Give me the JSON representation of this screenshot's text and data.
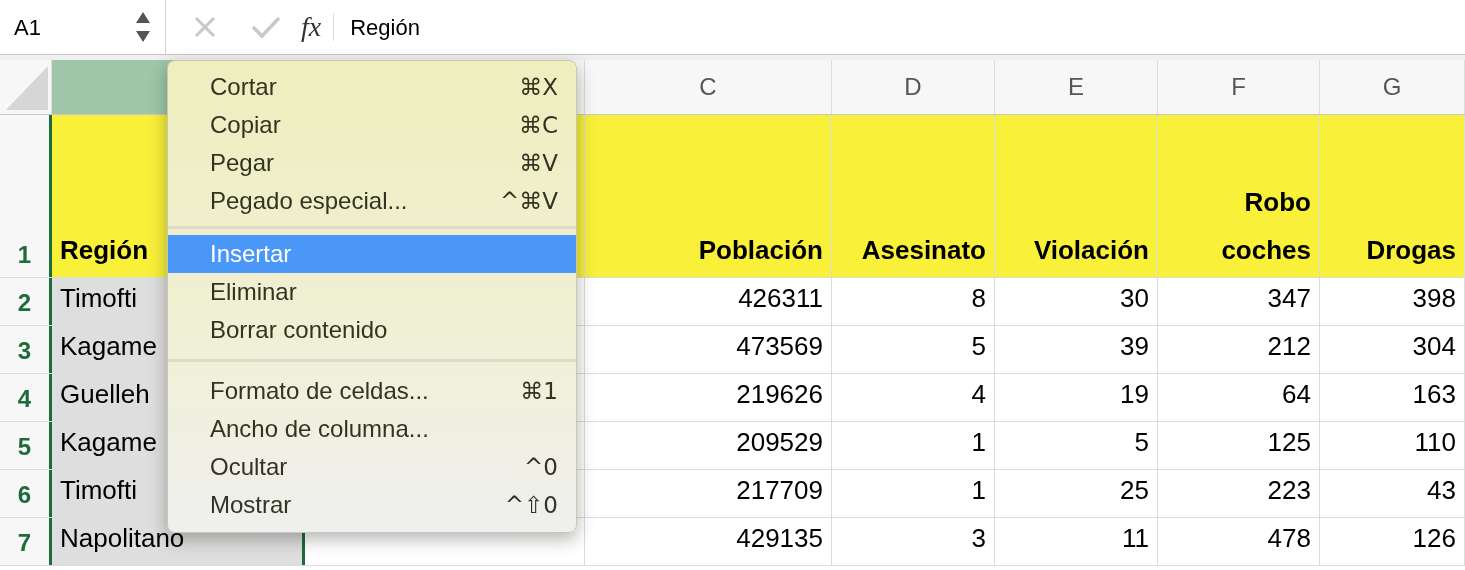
{
  "formula_bar": {
    "name_box": "A1",
    "function_label": "fx",
    "formula": "Región"
  },
  "columns": [
    {
      "selected": true
    },
    {
      "selected": false
    },
    {
      "label": "C",
      "selected": false
    },
    {
      "label": "D",
      "selected": false
    },
    {
      "label": "E",
      "selected": false
    },
    {
      "label": "F",
      "selected": false
    },
    {
      "label": "G",
      "selected": false
    }
  ],
  "header_row": {
    "number": "1",
    "cells": [
      "Región",
      "",
      "Población",
      "Asesinato",
      "Violación",
      "Robo coches",
      "Drogas"
    ]
  },
  "rows": [
    {
      "number": "2",
      "cells": [
        "Timofti",
        "",
        "426311",
        "8",
        "30",
        "347",
        "398"
      ]
    },
    {
      "number": "3",
      "cells": [
        "Kagame",
        "",
        "473569",
        "5",
        "39",
        "212",
        "304"
      ]
    },
    {
      "number": "4",
      "cells": [
        "Guelleh",
        "",
        "219626",
        "4",
        "19",
        "64",
        "163"
      ]
    },
    {
      "number": "5",
      "cells": [
        "Kagame",
        "",
        "209529",
        "1",
        "5",
        "125",
        "110"
      ]
    },
    {
      "number": "6",
      "cells": [
        "Timofti",
        "",
        "217709",
        "1",
        "25",
        "223",
        "43"
      ]
    },
    {
      "number": "7",
      "cells": [
        "Napolitano",
        "",
        "429135",
        "3",
        "11",
        "478",
        "126"
      ]
    }
  ],
  "context_menu": {
    "groups": [
      [
        {
          "label": "Cortar",
          "shortcut": "⌘X",
          "selected": false
        },
        {
          "label": "Copiar",
          "shortcut": "⌘C",
          "selected": false
        },
        {
          "label": "Pegar",
          "shortcut": "⌘V",
          "selected": false
        },
        {
          "label": "Pegado especial...",
          "shortcut": "^⌘V",
          "selected": false
        }
      ],
      [
        {
          "label": "Insertar",
          "selected": true
        },
        {
          "label": "Eliminar",
          "selected": false
        },
        {
          "label": "Borrar contenido",
          "selected": false
        }
      ],
      [
        {
          "label": "Formato de celdas...",
          "shortcut": "⌘1",
          "selected": false
        },
        {
          "label": "Ancho de columna...",
          "selected": false
        },
        {
          "label": "Ocultar",
          "shortcut": "^0",
          "selected": false
        },
        {
          "label": "Mostrar",
          "shortcut": "^⇧0",
          "selected": false
        }
      ]
    ]
  }
}
